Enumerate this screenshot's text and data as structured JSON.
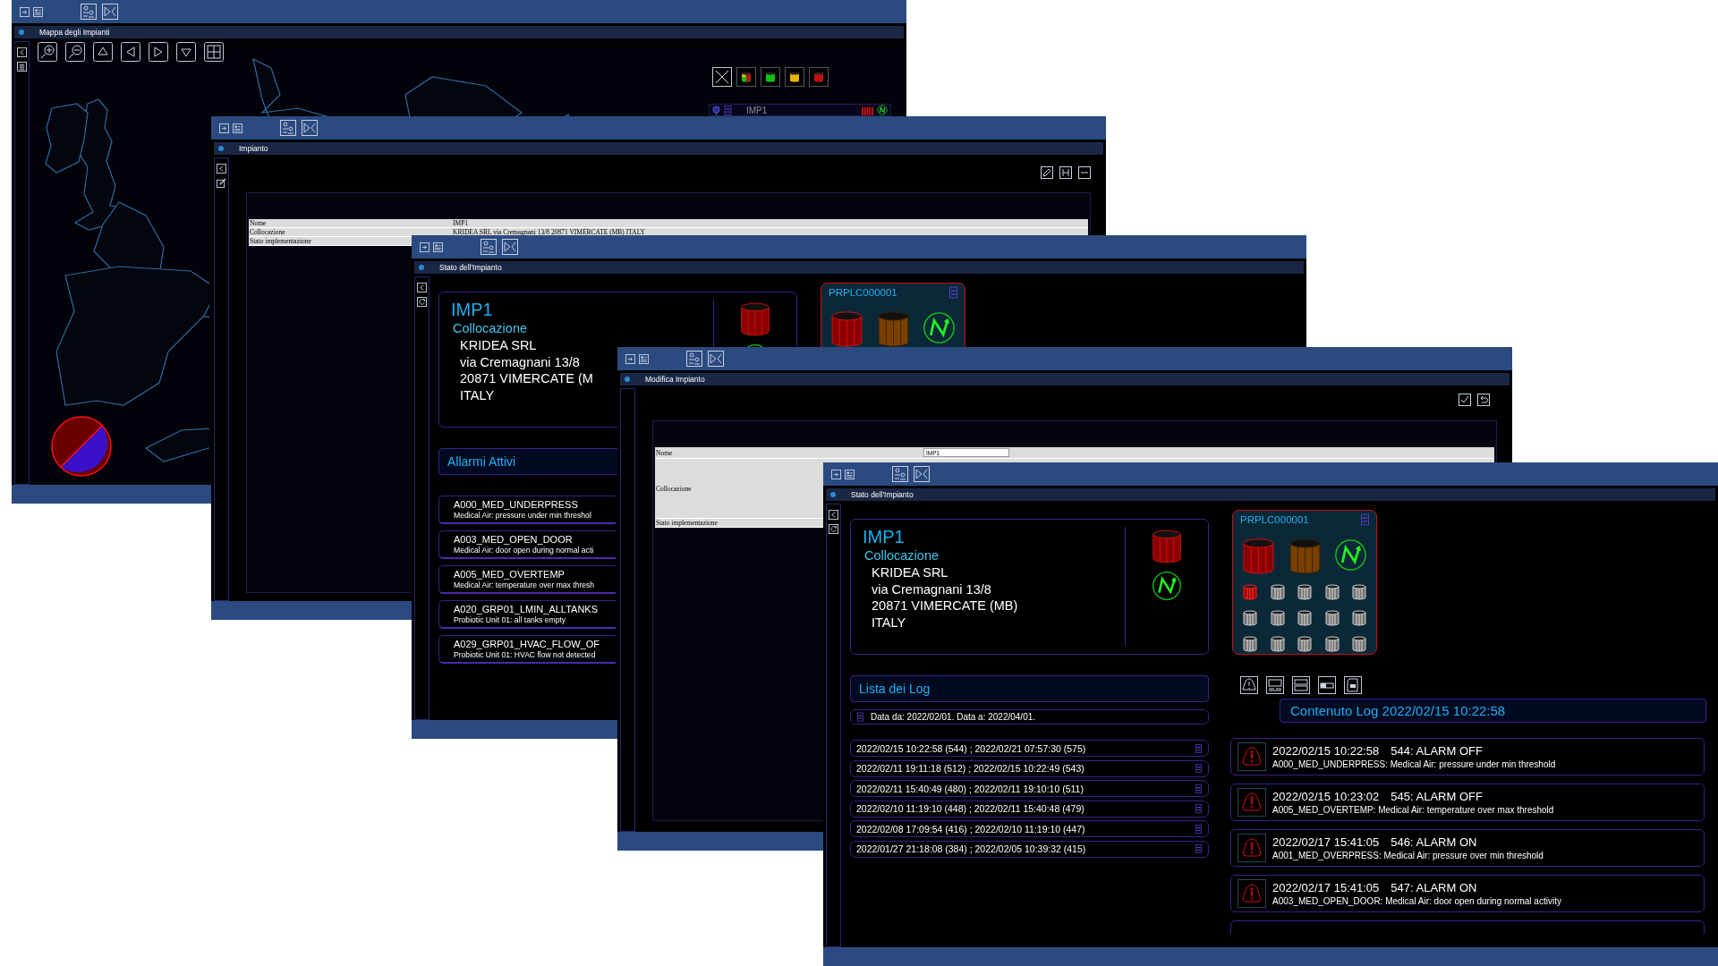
{
  "map_window": {
    "title": "Mappa degli Impianti",
    "plant": {
      "name": "IMP1"
    }
  },
  "plant_window": {
    "title": "Impianto",
    "fields": [
      {
        "label": "Nome",
        "value": "IMP1"
      },
      {
        "label": "Collocazione",
        "value": "KRIDEA SRL via Cremagnani 13/8 20871 VIMERCATE (MB) ITALY"
      },
      {
        "label": "Stato implementazione"
      }
    ]
  },
  "status_window": {
    "title": "Stato dell'Impianto",
    "plant": {
      "name": "IMP1",
      "location_label": "Collocazione",
      "address": [
        "KRIDEA SRL",
        "via Cremagnani 13/8",
        "20871 VIMERCATE (M",
        "ITALY"
      ]
    },
    "plc": {
      "name": "PRPLC000001"
    },
    "alarms_title": "Allarmi Attivi",
    "alarms": [
      {
        "code": "A000_MED_UNDERPRESS",
        "description": "Medical Air: pressure under min threshol"
      },
      {
        "code": "A003_MED_OPEN_DOOR",
        "description": "Medical Air: door open during normal acti"
      },
      {
        "code": "A005_MED_OVERTEMP",
        "description": "Medical Air: temperature over max thresh"
      },
      {
        "code": "A020_GRP01_LMIN_ALLTANKS",
        "description": "Probiotic Unit 01: all tanks empty"
      },
      {
        "code": "A029_GRP01_HVAC_FLOW_OF",
        "description": "Probiotic Unit 01: HVAC flow not detected"
      }
    ]
  },
  "edit_window": {
    "title": "Modifica Impianto",
    "fields": [
      {
        "label": "Nome",
        "value": "IMP1"
      },
      {
        "label": "Collocazione"
      },
      {
        "label": "Stato implementazione"
      }
    ]
  },
  "log_window": {
    "title": "Stato dell'Impianto",
    "plant": {
      "name": "IMP1",
      "location_label": "Collocazione",
      "address": [
        "KRIDEA SRL",
        "via Cremagnani 13/8",
        "20871 VIMERCATE (MB)",
        "ITALY"
      ]
    },
    "plc": {
      "name": "PRPLC000001",
      "units": [
        {
          "alarm": true
        },
        {
          "alarm": false
        },
        {
          "alarm": false
        },
        {
          "alarm": false
        },
        {
          "alarm": false
        },
        {
          "alarm": false
        },
        {
          "alarm": false
        },
        {
          "alarm": false
        },
        {
          "alarm": false
        },
        {
          "alarm": false
        },
        {
          "alarm": false
        },
        {
          "alarm": false
        },
        {
          "alarm": false
        },
        {
          "alarm": false
        },
        {
          "alarm": false
        }
      ]
    },
    "logs_title": "Lista dei Log",
    "date_filter": "Data da: 2022/02/01. Data a: 2022/04/01.",
    "logs": [
      "2022/02/15 10:22:58 (544) ; 2022/02/21 07:57:30 (575)",
      "2022/02/11 19:11:18 (512) ; 2022/02/15 10:22:49 (543)",
      "2022/02/11 15:40:49 (480) ; 2022/02/11 19:10:10 (511)",
      "2022/02/10 11:19:10 (448) ; 2022/02/11 15:40:48 (479)",
      "2022/02/08 17:09:54 (416) ; 2022/02/10 11:19:10 (447)",
      "2022/01/27 21:18:08 (384) ; 2022/02/05 10:39:32 (415)"
    ],
    "content_title": "Contenuto Log 2022/02/15 10:22:58",
    "entries": [
      {
        "time": "2022/02/15 10:22:58",
        "event": "544: ALARM OFF",
        "detail": "A000_MED_UNDERPRESS: Medical Air: pressure under min threshold"
      },
      {
        "time": "2022/02/15 10:23:02",
        "event": "545: ALARM OFF",
        "detail": "A005_MED_OVERTEMP: Medical Air: temperature over max threshold"
      },
      {
        "time": "2022/02/17 15:41:05",
        "event": "546: ALARM ON",
        "detail": "A001_MED_OVERPRESS: Medical Air: pressure over min threshold"
      },
      {
        "time": "2022/02/17 15:41:05",
        "event": "547: ALARM ON",
        "detail": "A003_MED_OPEN_DOOR: Medical Air: door open during normal activity"
      }
    ]
  }
}
